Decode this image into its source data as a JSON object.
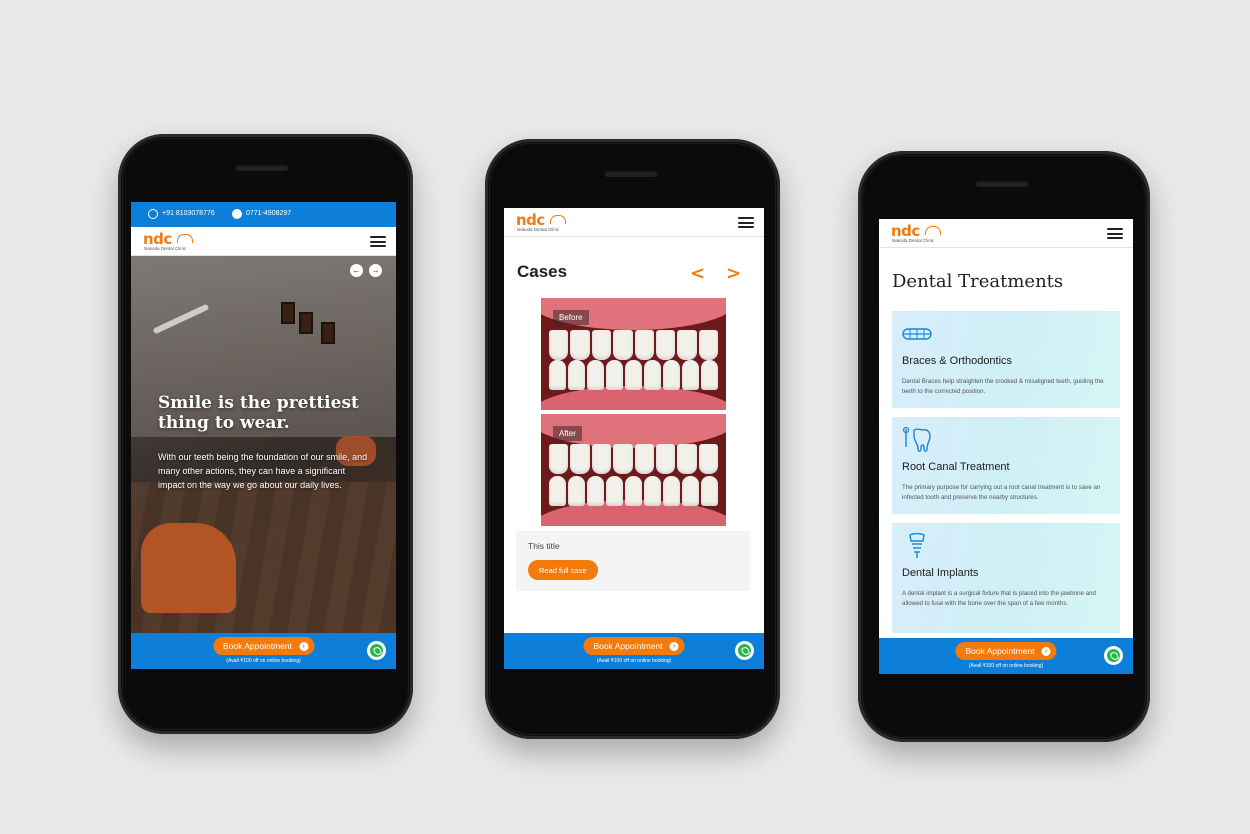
{
  "phone1": {
    "topbar": {
      "phone1": "+91 8103078776",
      "phone2": "0771-4908297"
    },
    "logo": {
      "brand": "ndc",
      "subtitle": "Nakoda Dental Clinic"
    },
    "carousel": {
      "prev": "←",
      "next": "→"
    },
    "hero": {
      "title": "Smile is the prettiest thing to wear.",
      "text": "With our teeth being the foundation of our smile, and many other actions, they can have a significant impact on the way we go about our daily lives."
    },
    "bottom": {
      "book_label": "Book Appointment",
      "avail": "(Avail ₹100 off on online booking)"
    }
  },
  "phone2": {
    "logo": {
      "brand": "ndc",
      "subtitle": "Nakoda Dental Clinic"
    },
    "cases": {
      "title": "Cases",
      "prev": "<",
      "next": ">",
      "before_label": "Before",
      "after_label": "After",
      "case_title": "This title",
      "read_label": "Read full case"
    },
    "bottom": {
      "book_label": "Book Appointment",
      "avail": "(Avail ₹100 off on online booking)"
    }
  },
  "phone3": {
    "logo": {
      "brand": "ndc",
      "subtitle": "Nakoda Dental Clinic"
    },
    "title": "Dental Treatments",
    "treatments": [
      {
        "name": "Braces & Orthodontics",
        "desc": "Dental Braces help straighten the crooked & misaligned teeth, guiding the teeth to the corrected position.",
        "icon": "braces-icon"
      },
      {
        "name": "Root Canal Treatment",
        "desc": "The primary purpose for carrying out a root canal treatment is to save an infected tooth and preserve the nearby structures.",
        "icon": "tooth-icon"
      },
      {
        "name": "Dental Implants",
        "desc": "A dental implant is a surgical fixture that is placed into the jawbone and allowed to fuse with the bone over the span of a few months.",
        "icon": "implant-icon"
      }
    ],
    "bottom": {
      "book_label": "Book Appointment",
      "avail": "(Avail ₹100 off on online booking)"
    }
  },
  "colors": {
    "brand_blue": "#0d7fd8",
    "brand_orange": "#f47b0b",
    "whatsapp_green": "#28b64a"
  }
}
